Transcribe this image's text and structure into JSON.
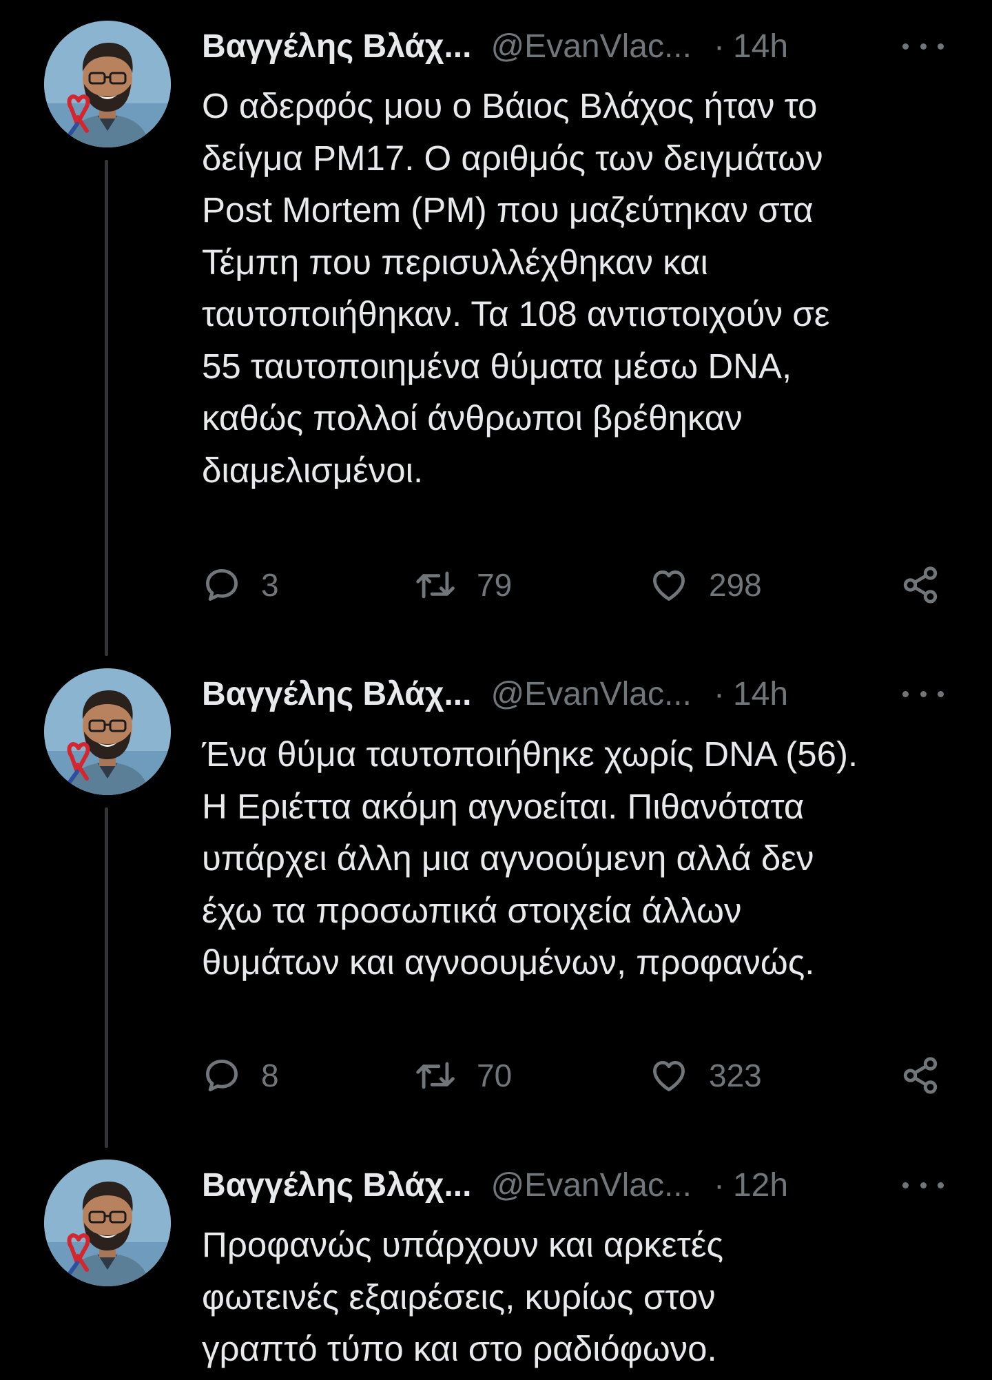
{
  "colors": {
    "background": "#000000",
    "text_primary": "#e7e9ea",
    "text_secondary": "#71767b",
    "thread_line": "#333639"
  },
  "icons": {
    "reply": "speech-bubble-icon",
    "retweet": "retweet-arrows-icon",
    "like": "heart-outline-icon",
    "share": "share-nodes-icon",
    "more": "three-dots-icon"
  },
  "tweets": [
    {
      "display_name": "Βαγγέλης Βλάχ...",
      "handle": "@EvanVlac...",
      "separator": "·",
      "time": "14h",
      "text": "Ο αδερφός μου ο Βάιος Βλάχος ήταν το\nδείγμα PM17. Ο αριθμός των δειγμάτων\nPost Mortem (PM) που μαζεύτηκαν στα\nΤέμπη που περισυλλέχθηκαν και\nταυτοποιήθηκαν. Τα 108 αντιστοιχούν σε\n55 ταυτοποιημένα θύματα μέσω DNA,\nκαθώς πολλοί άνθρωποι βρέθηκαν\nδιαμελισμένοι.",
      "replies": "3",
      "retweets": "79",
      "likes": "298"
    },
    {
      "display_name": "Βαγγέλης Βλάχ...",
      "handle": "@EvanVlac...",
      "separator": "·",
      "time": "14h",
      "text": "Ένα θύμα ταυτοποιήθηκε χωρίς DNA (56).\nΗ Εριέττα ακόμη αγνοείται. Πιθανότατα\nυπάρχει άλλη μια αγνοούμενη αλλά δεν\nέχω τα προσωπικά στοιχεία άλλων\nθυμάτων και αγνοουμένων, προφανώς.",
      "replies": "8",
      "retweets": "70",
      "likes": "323"
    },
    {
      "display_name": "Βαγγέλης Βλάχ...",
      "handle": "@EvanVlac...",
      "separator": "·",
      "time": "12h",
      "text": "Προφανώς υπάρχουν και αρκετές\nφωτεινές εξαιρέσεις, κυρίως στον\nγραπτό τύπο και στο ραδιόφωνο."
    }
  ]
}
